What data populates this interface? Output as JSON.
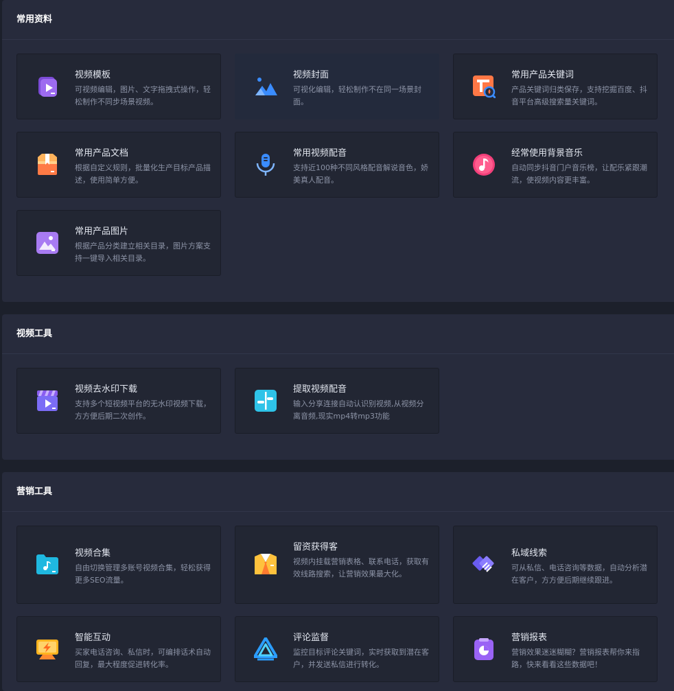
{
  "sections": [
    {
      "title": "常用资料",
      "cards": [
        {
          "title": "视频模板",
          "desc": "可视频编辑，图片、文字拖拽式操作，轻松制作不同步场景视频。",
          "icon": "video-template-icon"
        },
        {
          "title": "视频封面",
          "desc": "可视化编辑，轻松制作不在同一场景封面。",
          "icon": "mountain-image-icon"
        },
        {
          "title": "常用产品关键词",
          "desc": "产品关键词归类保存，支持挖掘百度、抖音平台高级搜索量关键词。",
          "icon": "keyword-search-icon"
        },
        {
          "title": "常用产品文档",
          "desc": "根据自定义规则，批量化生产目标产品描述，使用简单方便。",
          "icon": "document-box-icon"
        },
        {
          "title": "常用视频配音",
          "desc": "支持近100种不同风格配音解说音色，娇美真人配音。",
          "icon": "microphone-icon"
        },
        {
          "title": "经常使用背景音乐",
          "desc": "自动同步抖音门户音乐榜，让配乐紧跟潮流，使视频内容更丰富。",
          "icon": "music-note-icon"
        },
        {
          "title": "常用产品图片",
          "desc": "根据产品分类建立相关目录，图片方案支持一键导入相关目录。",
          "icon": "product-image-icon"
        }
      ]
    },
    {
      "title": "视频工具",
      "cards": [
        {
          "title": "视频去水印下载",
          "desc": "支持多个短视频平台的无水印视频下载，方方便后期二次创作。",
          "icon": "clapperboard-icon"
        },
        {
          "title": "提取视频配音",
          "desc": "输入分享连接自动认识别视频,从视频分离音频,现实mp4转mp3功能",
          "icon": "audio-extract-icon"
        }
      ]
    },
    {
      "title": "营销工具",
      "cards": [
        {
          "title": "视频合集",
          "desc": "自由切换管理多账号视频合集，轻松获得更多SEO流量。",
          "icon": "folder-music-icon"
        },
        {
          "title": "留资获得客",
          "desc": "视频内挂载营销表格、联系电话，获取有效线路搜索，让营销效果最大化。",
          "icon": "suit-icon"
        },
        {
          "title": "私域线索",
          "desc": "可从私信、电话咨询等数据，自动分析潜在客户，方方便后期继续跟进。",
          "icon": "handshake-icon"
        },
        {
          "title": "智能互动",
          "desc": "买家电话咨询、私信时，可编排话术自动回复，最大程度促进转化率。",
          "icon": "lightning-monitor-icon"
        },
        {
          "title": "评论监督",
          "desc": "监控目标评论关键词，实时获取到潜在客户，并发送私信进行转化。",
          "icon": "triangle-logo-icon"
        },
        {
          "title": "营销报表",
          "desc": "营销效果迷迷糊糊？营销报表帮你来指路，快来看看这些数据吧！",
          "icon": "pie-report-icon"
        }
      ]
    }
  ]
}
